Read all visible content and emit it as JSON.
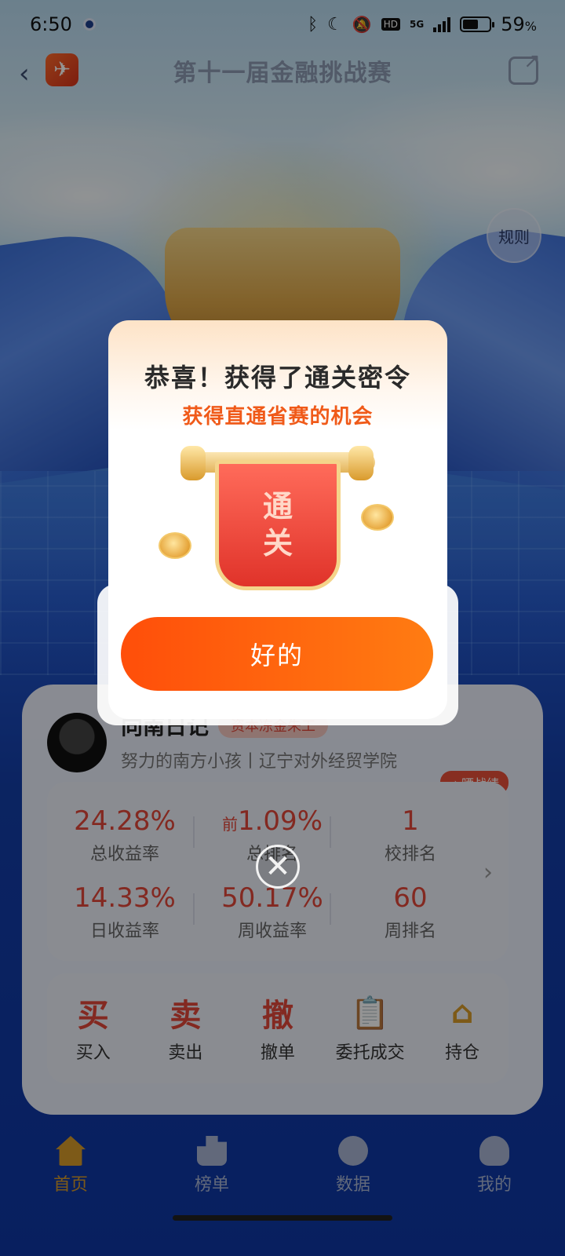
{
  "status_bar": {
    "time": "6:50",
    "hd_label": "HD",
    "net_label": "5G",
    "battery_percent": "59",
    "battery_unit": "%",
    "battery_level": 0.59
  },
  "header": {
    "title": "第十一届金融挑战赛",
    "back_icon": "chevron-left-icon",
    "share_icon": "share-icon",
    "logo_glyph": "✈"
  },
  "rules_button": {
    "label": "规则"
  },
  "profile": {
    "name": "向南日记",
    "badge": "资本冻金朱工",
    "subtitle": "努力的南方小孩丨辽宁对外经贸学院",
    "share_button": "晒战绩",
    "stats": [
      {
        "value": "24.28%",
        "label": "总收益率"
      },
      {
        "prefix": "前",
        "value": "1.09%",
        "label": "总排名"
      },
      {
        "value": "1",
        "label": "校排名"
      },
      {
        "value": "14.33%",
        "label": "日收益率"
      },
      {
        "value": "50.17%",
        "label": "周收益率"
      },
      {
        "value": "60",
        "label": "周排名"
      }
    ]
  },
  "actions": [
    {
      "glyph": "买",
      "label": "买入"
    },
    {
      "glyph": "卖",
      "label": "卖出"
    },
    {
      "glyph": "撤",
      "label": "撤单"
    },
    {
      "glyph": "📋",
      "label": "委托成交"
    },
    {
      "glyph": "⌂",
      "label": "持仓"
    }
  ],
  "bottom_nav": [
    {
      "label": "首页",
      "icon": "home-icon",
      "active": true
    },
    {
      "label": "榜单",
      "icon": "leaderboard-icon",
      "active": false
    },
    {
      "label": "数据",
      "icon": "pie-chart-icon",
      "active": false
    },
    {
      "label": "我的",
      "icon": "user-icon",
      "active": false
    }
  ],
  "modal": {
    "title": "恭喜！获得了通关密令",
    "subtitle": "获得直通省赛的机会",
    "scroll_text_line1": "通",
    "scroll_text_line2": "关",
    "ok_button": "好的",
    "close_glyph": "✕"
  },
  "colors": {
    "accent_orange": "#ff5a0e",
    "stat_red": "#e2483a",
    "gold": "#d89b2a"
  }
}
